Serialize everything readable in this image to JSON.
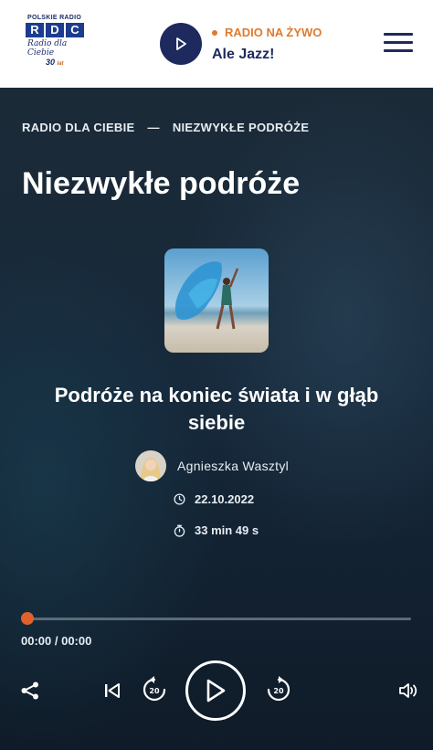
{
  "header": {
    "logo": {
      "top_text": "POLSKIE RADIO",
      "letters": [
        "R",
        "D",
        "C"
      ],
      "script_text": "Radio dla Ciebie",
      "anniversary": "30",
      "anniversary_suffix": "lat"
    },
    "live": {
      "label": "RADIO NA ŻYWO",
      "station": "Ale Jazz!"
    },
    "icons": {
      "live_play": "play-icon",
      "menu": "hamburger-menu-icon"
    }
  },
  "breadcrumb": {
    "items": [
      "RADIO DLA CIEBIE",
      "NIEZWYKŁE PODRÓŻE"
    ],
    "separator": "—"
  },
  "page_title": "Niezwykłe podróże",
  "episode": {
    "title": "Podróże na koniec świata i w głąb siebie",
    "author": "Agnieszka Wasztyl",
    "date": "22.10.2022",
    "duration": "33 min 49 s"
  },
  "player": {
    "time": "00:00 / 00:00",
    "progress": 0,
    "skip_seconds": "20",
    "icons": [
      "share-icon",
      "skip-to-start-icon",
      "rewind-20-icon",
      "play-icon",
      "forward-20-icon",
      "volume-icon"
    ]
  },
  "colors": {
    "accent": "#e2612b",
    "brand_navy": "#1e2a5e",
    "live_orange": "#e07a2e"
  }
}
